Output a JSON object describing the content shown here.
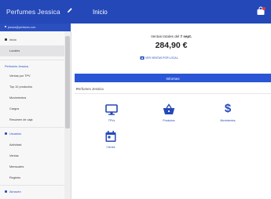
{
  "app": {
    "brand": "Perfumes Jessica",
    "page_title": "Inicio",
    "user_email": "jessica@perfumes.com"
  },
  "sidebar": {
    "items": [
      {
        "label": "Inicio",
        "type": "item",
        "active": false,
        "icon": "home-icon"
      },
      {
        "label": "Locales",
        "type": "item",
        "active": true,
        "icon": ""
      },
      {
        "label": "Perfumes Jessica",
        "type": "section",
        "active": false,
        "icon": ""
      },
      {
        "label": "Ventas por TPV",
        "type": "item",
        "active": false,
        "icon": ""
      },
      {
        "label": "Top 10 productos",
        "type": "item",
        "active": false,
        "icon": ""
      },
      {
        "label": "Movimientos",
        "type": "item",
        "active": false,
        "icon": ""
      },
      {
        "label": "Cargos",
        "type": "item",
        "active": false,
        "icon": ""
      },
      {
        "label": "Resumen de caja",
        "type": "item",
        "active": false,
        "icon": ""
      },
      {
        "label": "Usuarios",
        "type": "item",
        "active": false,
        "icon": "users-icon"
      },
      {
        "label": "Actividad",
        "type": "item",
        "active": false,
        "icon": ""
      },
      {
        "label": "Ventas",
        "type": "item",
        "active": false,
        "icon": ""
      },
      {
        "label": "Mensuales",
        "type": "item",
        "active": false,
        "icon": ""
      },
      {
        "label": "Registro",
        "type": "item",
        "active": false,
        "icon": ""
      },
      {
        "label": "Almacén",
        "type": "item",
        "active": false,
        "icon": "warehouse-icon"
      }
    ]
  },
  "summary": {
    "label_prefix": "Ventas totales del",
    "label_date": "7 sept.",
    "amount": "284,90 €",
    "link_label": "VER VENTAS POR LOCAL"
  },
  "reports": {
    "title": "Informes",
    "store_select": "Perfumes Jessica",
    "tiles": [
      {
        "label": "TPVs",
        "icon": "monitor-icon"
      },
      {
        "label": "Productos",
        "icon": "basket-icon"
      },
      {
        "label": "Movimientos",
        "icon": "dollar-icon"
      },
      {
        "label": "Cierres",
        "icon": "calendar-icon"
      }
    ]
  },
  "colors": {
    "accent": "#2448b8",
    "section_bar": "#2a56d6"
  }
}
